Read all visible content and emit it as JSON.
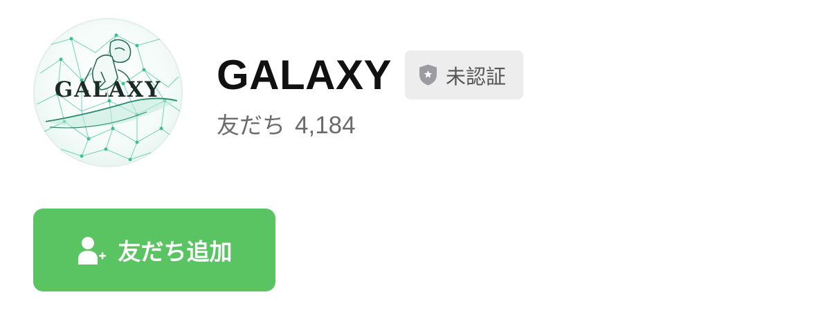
{
  "profile": {
    "name": "GALAXY",
    "avatar_text": "GALAXY",
    "avatar_icon": "galaxy-logo-icon"
  },
  "badge": {
    "icon": "shield-star-icon",
    "label": "未認証",
    "color": "#ededee"
  },
  "friends": {
    "label": "友だち",
    "count": "4,184"
  },
  "add_button": {
    "icon": "add-friend-icon",
    "label": "友だち追加",
    "color": "#5ac463"
  }
}
